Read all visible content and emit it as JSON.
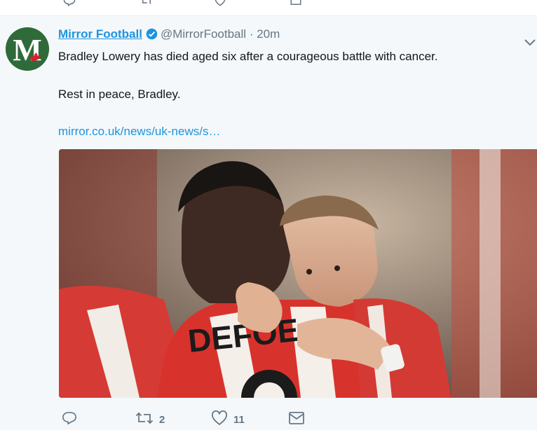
{
  "tweet": {
    "display_name": "Mirror Football",
    "handle": "@MirrorFootball",
    "separator": "·",
    "time": "20m",
    "text_line1": "Bradley Lowery has died aged six after a courageous battle with cancer.",
    "text_line2": "Rest in peace, Bradley.",
    "link": "mirror.co.uk/news/uk-news/s…",
    "avatar_letter": "M",
    "shirt_lettering": "DEFOE",
    "actions": {
      "reply_icon": "reply-icon",
      "retweet_icon": "retweet-icon",
      "retweet_count": "2",
      "like_icon": "heart-icon",
      "like_count": "11",
      "dm_icon": "envelope-icon"
    }
  },
  "colors": {
    "link_blue": "#1c94e0",
    "muted_gray": "#657786",
    "tweet_bg": "#f5f8fa",
    "avatar_green": "#2f6b3a"
  }
}
